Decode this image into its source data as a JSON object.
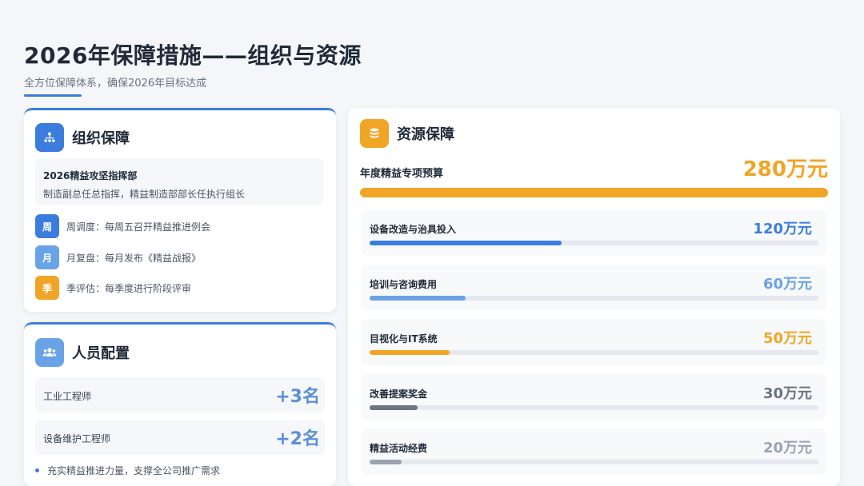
{
  "header": {
    "title": "2026年保障措施——组织与资源",
    "subtitle": "全方位保障体系，确保2026年目标达成"
  },
  "org": {
    "title": "组织保障",
    "icon": "org-chart-icon",
    "command_name": "2026精益攻坚指挥部",
    "command_desc": "制造副总任总指挥，精益制造部部长任执行组长",
    "schedule": [
      {
        "badge": "周",
        "text": "周调度：每周五召开精益推进例会",
        "color": "#3b7ddd"
      },
      {
        "badge": "月",
        "text": "月复盘：每月发布《精益战报》",
        "color": "#6aa2e6"
      },
      {
        "badge": "季",
        "text": "季评估：每季度进行阶段评审",
        "color": "#f0a526"
      }
    ]
  },
  "people": {
    "title": "人员配置",
    "icon": "users-icon",
    "roles": [
      {
        "name": "工业工程师",
        "count": "+3名"
      },
      {
        "name": "设备维护工程师",
        "count": "+2名"
      }
    ],
    "note": "充实精益推进力量，支撑全公司推广需求"
  },
  "resources": {
    "title": "资源保障",
    "icon": "coins-icon",
    "budget_label": "年度精益专项预算",
    "budget_value": "280万元",
    "budget_total": 280,
    "items": [
      {
        "name": "设备改造与治具投入",
        "value": "120万元",
        "amount": 120,
        "color": "#3b7ddd"
      },
      {
        "name": "培训与咨询费用",
        "value": "60万元",
        "amount": 60,
        "color": "#6aa2e6"
      },
      {
        "name": "目视化与IT系统",
        "value": "50万元",
        "amount": 50,
        "color": "#f0a526"
      },
      {
        "name": "改善提案奖金",
        "value": "30万元",
        "amount": 30,
        "color": "#6b7280"
      },
      {
        "name": "精益活动经费",
        "value": "20万元",
        "amount": 20,
        "color": "#9aa3b0"
      }
    ]
  }
}
